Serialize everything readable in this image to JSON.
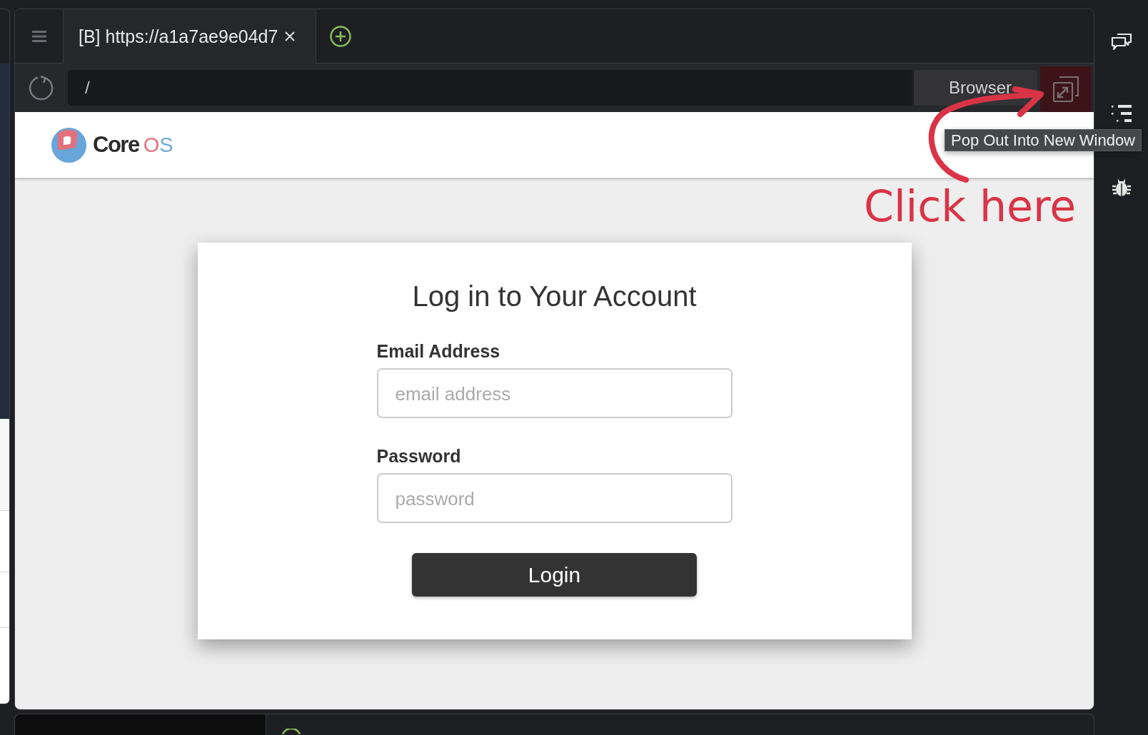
{
  "window": {
    "tabs": [
      {
        "title": "[B] https://a1a7ae9e04d7",
        "selected": true
      }
    ],
    "address_bar": {
      "value": "/"
    },
    "view_mode": {
      "value": "Browser"
    },
    "tooltip": "Pop Out Into New Window"
  },
  "page": {
    "brand": {
      "name": "Core",
      "suffix": "OS"
    },
    "login_form": {
      "title": "Log in to Your Account",
      "fields": [
        {
          "label": "Email Address",
          "placeholder": "email address"
        },
        {
          "label": "Password",
          "placeholder": "password"
        }
      ],
      "submit": "Login"
    }
  },
  "annotation": {
    "text": "Click here"
  }
}
